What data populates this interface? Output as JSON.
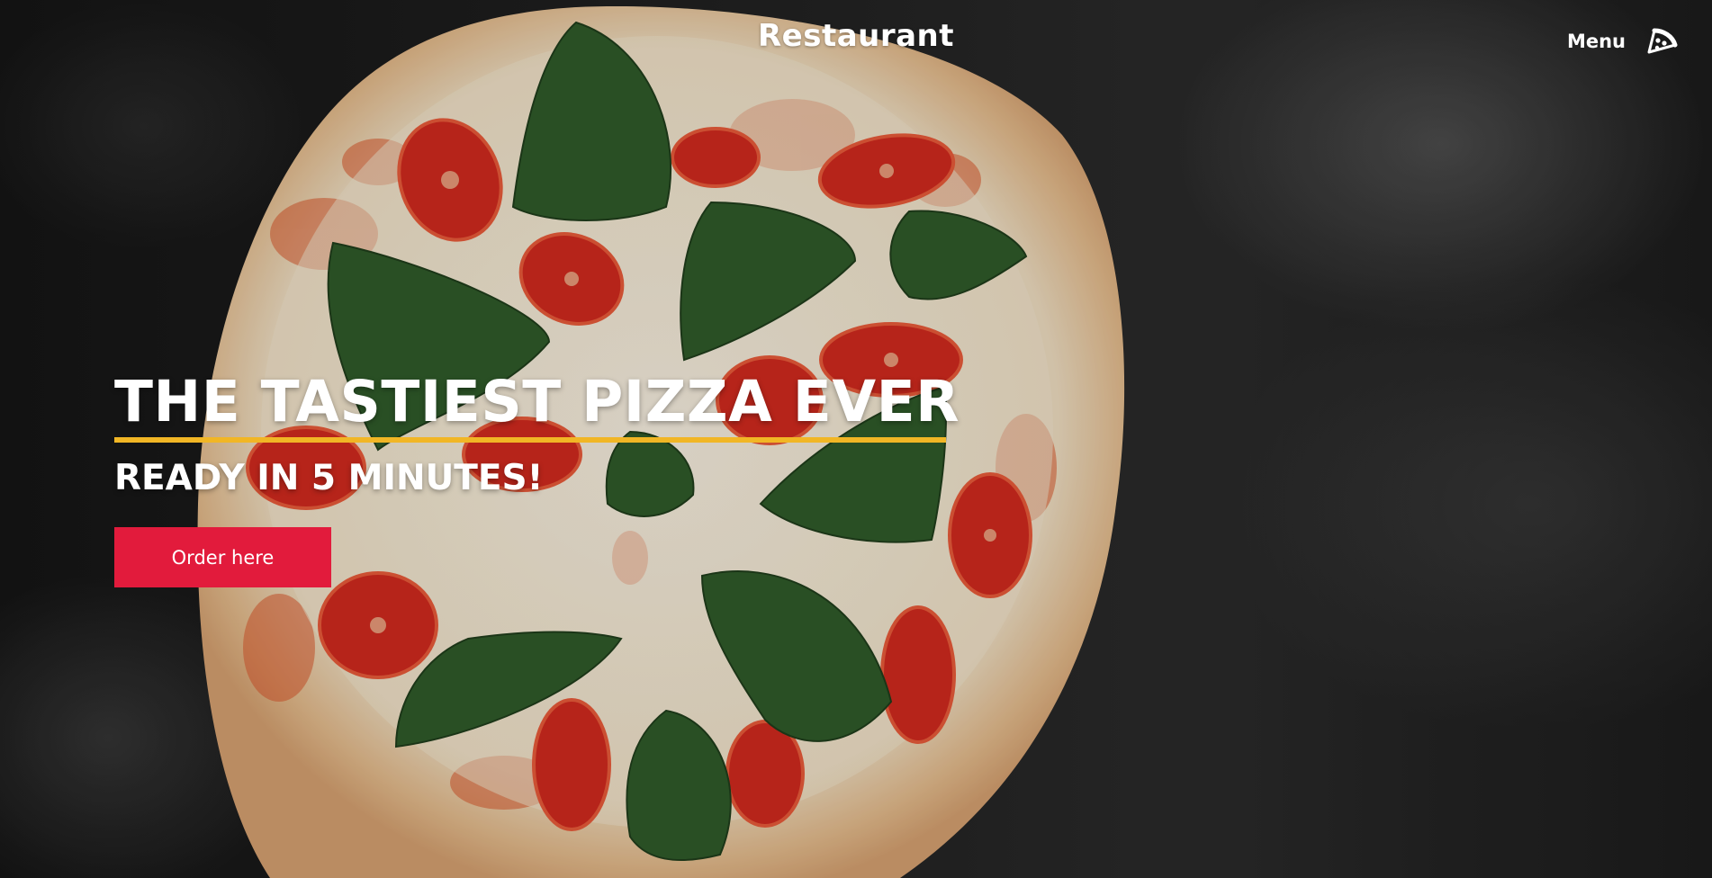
{
  "header": {
    "brand": "Restaurant",
    "menu_label": "Menu",
    "menu_icon": "pizza-slice-icon"
  },
  "hero": {
    "title": "THE TASTIEST PIZZA EVER",
    "subtitle": "READY IN 5 MINUTES!",
    "cta_label": "Order here"
  },
  "colors": {
    "accent_underline": "#f1b625",
    "cta_background": "#e21b3c",
    "text": "#ffffff",
    "background": "#1a1a1a"
  }
}
